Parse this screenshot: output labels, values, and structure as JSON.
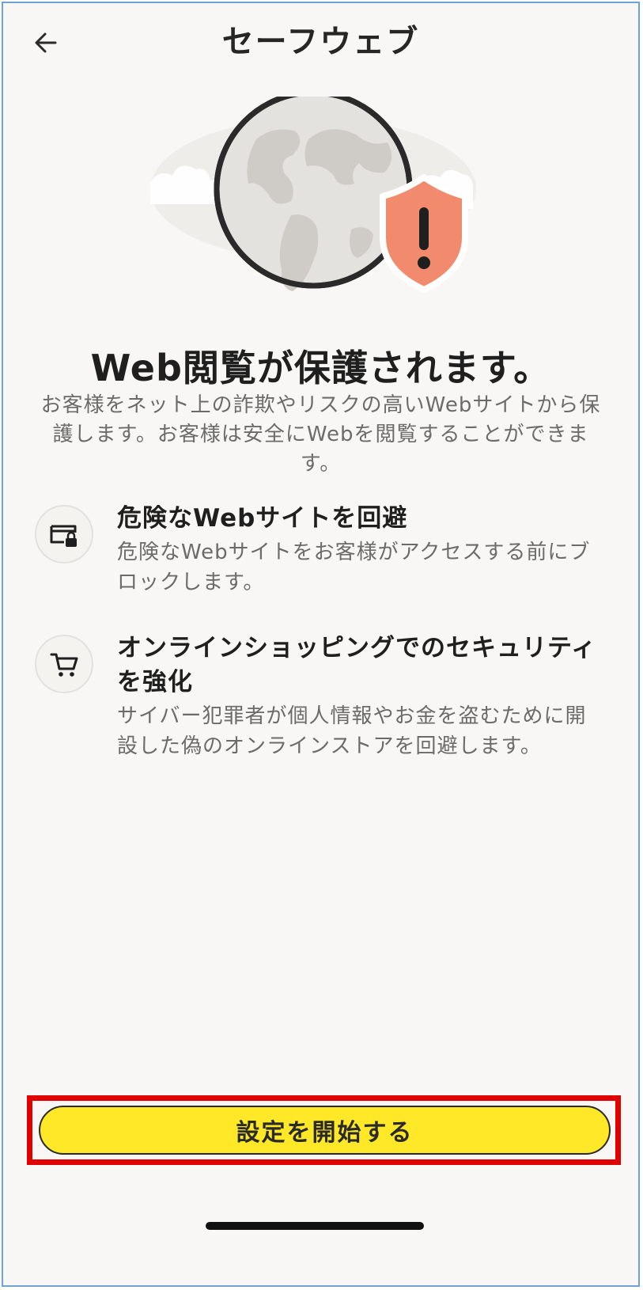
{
  "header": {
    "title": "セーフウェブ",
    "back_icon": "arrow-left-icon"
  },
  "hero": {
    "globe_icon": "globe-icon",
    "shield_icon": "shield-warning-icon",
    "accent_color": "#f28a6e"
  },
  "headline": "Web閲覧が保護されます。",
  "intro": "お客様をネット上の詐欺やリスクの高いWebサイトから保護します。お客様は安全にWebを閲覧することができます。",
  "features": [
    {
      "icon": "browser-lock-icon",
      "title": "危険なWebサイトを回避",
      "description": "危険なWebサイトをお客様がアクセスする前にブロックします。"
    },
    {
      "icon": "shopping-cart-icon",
      "title": "オンラインショッピングでのセキュリティを強化",
      "description": "サイバー犯罪者が個人情報やお金を盗むために開設した偽のオンラインストアを回避します。"
    }
  ],
  "cta": {
    "label": "設定を開始する",
    "color": "#ffe827",
    "highlight_color": "#e00000"
  }
}
